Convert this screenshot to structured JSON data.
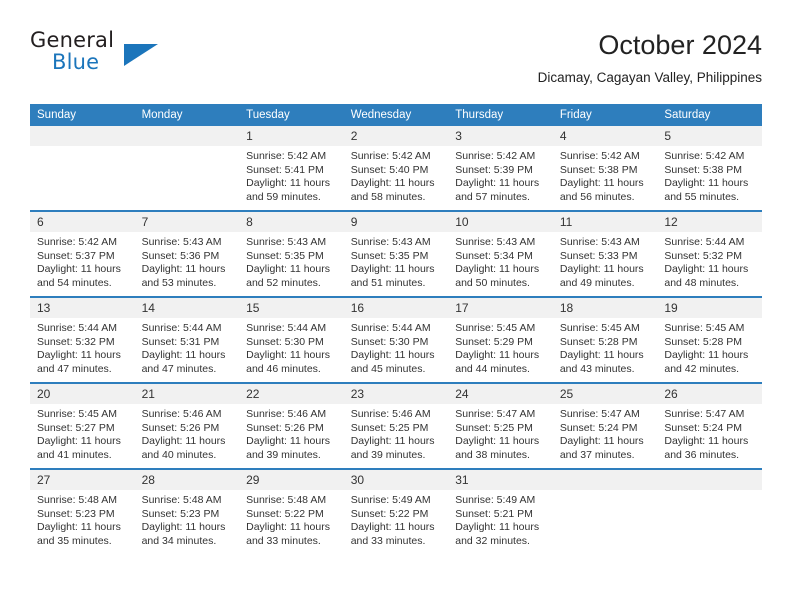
{
  "brand": {
    "name_top": "General",
    "name_bottom": "Blue",
    "triangle_icon": "brand-triangle-icon",
    "accent_color": "#1b75bb"
  },
  "header": {
    "month_title": "October 2024",
    "location": "Dicamay, Cagayan Valley, Philippines"
  },
  "theme": {
    "header_blue": "#2e7ebd",
    "daynum_band": "#f1f1f1",
    "text": "#333333"
  },
  "calendar": {
    "weekday_headers": [
      "Sunday",
      "Monday",
      "Tuesday",
      "Wednesday",
      "Thursday",
      "Friday",
      "Saturday"
    ],
    "labels": {
      "sunrise_prefix": "Sunrise:",
      "sunset_prefix": "Sunset:",
      "daylight_prefix": "Daylight:"
    },
    "weeks": [
      [
        {
          "day": "",
          "sunrise": "",
          "sunset": "",
          "daylight": "",
          "blank": true
        },
        {
          "day": "",
          "sunrise": "",
          "sunset": "",
          "daylight": "",
          "blank": true
        },
        {
          "day": "1",
          "sunrise": "Sunrise: 5:42 AM",
          "sunset": "Sunset: 5:41 PM",
          "daylight": "Daylight: 11 hours and 59 minutes."
        },
        {
          "day": "2",
          "sunrise": "Sunrise: 5:42 AM",
          "sunset": "Sunset: 5:40 PM",
          "daylight": "Daylight: 11 hours and 58 minutes."
        },
        {
          "day": "3",
          "sunrise": "Sunrise: 5:42 AM",
          "sunset": "Sunset: 5:39 PM",
          "daylight": "Daylight: 11 hours and 57 minutes."
        },
        {
          "day": "4",
          "sunrise": "Sunrise: 5:42 AM",
          "sunset": "Sunset: 5:38 PM",
          "daylight": "Daylight: 11 hours and 56 minutes."
        },
        {
          "day": "5",
          "sunrise": "Sunrise: 5:42 AM",
          "sunset": "Sunset: 5:38 PM",
          "daylight": "Daylight: 11 hours and 55 minutes."
        }
      ],
      [
        {
          "day": "6",
          "sunrise": "Sunrise: 5:42 AM",
          "sunset": "Sunset: 5:37 PM",
          "daylight": "Daylight: 11 hours and 54 minutes."
        },
        {
          "day": "7",
          "sunrise": "Sunrise: 5:43 AM",
          "sunset": "Sunset: 5:36 PM",
          "daylight": "Daylight: 11 hours and 53 minutes."
        },
        {
          "day": "8",
          "sunrise": "Sunrise: 5:43 AM",
          "sunset": "Sunset: 5:35 PM",
          "daylight": "Daylight: 11 hours and 52 minutes."
        },
        {
          "day": "9",
          "sunrise": "Sunrise: 5:43 AM",
          "sunset": "Sunset: 5:35 PM",
          "daylight": "Daylight: 11 hours and 51 minutes."
        },
        {
          "day": "10",
          "sunrise": "Sunrise: 5:43 AM",
          "sunset": "Sunset: 5:34 PM",
          "daylight": "Daylight: 11 hours and 50 minutes."
        },
        {
          "day": "11",
          "sunrise": "Sunrise: 5:43 AM",
          "sunset": "Sunset: 5:33 PM",
          "daylight": "Daylight: 11 hours and 49 minutes."
        },
        {
          "day": "12",
          "sunrise": "Sunrise: 5:44 AM",
          "sunset": "Sunset: 5:32 PM",
          "daylight": "Daylight: 11 hours and 48 minutes."
        }
      ],
      [
        {
          "day": "13",
          "sunrise": "Sunrise: 5:44 AM",
          "sunset": "Sunset: 5:32 PM",
          "daylight": "Daylight: 11 hours and 47 minutes."
        },
        {
          "day": "14",
          "sunrise": "Sunrise: 5:44 AM",
          "sunset": "Sunset: 5:31 PM",
          "daylight": "Daylight: 11 hours and 47 minutes."
        },
        {
          "day": "15",
          "sunrise": "Sunrise: 5:44 AM",
          "sunset": "Sunset: 5:30 PM",
          "daylight": "Daylight: 11 hours and 46 minutes."
        },
        {
          "day": "16",
          "sunrise": "Sunrise: 5:44 AM",
          "sunset": "Sunset: 5:30 PM",
          "daylight": "Daylight: 11 hours and 45 minutes."
        },
        {
          "day": "17",
          "sunrise": "Sunrise: 5:45 AM",
          "sunset": "Sunset: 5:29 PM",
          "daylight": "Daylight: 11 hours and 44 minutes."
        },
        {
          "day": "18",
          "sunrise": "Sunrise: 5:45 AM",
          "sunset": "Sunset: 5:28 PM",
          "daylight": "Daylight: 11 hours and 43 minutes."
        },
        {
          "day": "19",
          "sunrise": "Sunrise: 5:45 AM",
          "sunset": "Sunset: 5:28 PM",
          "daylight": "Daylight: 11 hours and 42 minutes."
        }
      ],
      [
        {
          "day": "20",
          "sunrise": "Sunrise: 5:45 AM",
          "sunset": "Sunset: 5:27 PM",
          "daylight": "Daylight: 11 hours and 41 minutes."
        },
        {
          "day": "21",
          "sunrise": "Sunrise: 5:46 AM",
          "sunset": "Sunset: 5:26 PM",
          "daylight": "Daylight: 11 hours and 40 minutes."
        },
        {
          "day": "22",
          "sunrise": "Sunrise: 5:46 AM",
          "sunset": "Sunset: 5:26 PM",
          "daylight": "Daylight: 11 hours and 39 minutes."
        },
        {
          "day": "23",
          "sunrise": "Sunrise: 5:46 AM",
          "sunset": "Sunset: 5:25 PM",
          "daylight": "Daylight: 11 hours and 39 minutes."
        },
        {
          "day": "24",
          "sunrise": "Sunrise: 5:47 AM",
          "sunset": "Sunset: 5:25 PM",
          "daylight": "Daylight: 11 hours and 38 minutes."
        },
        {
          "day": "25",
          "sunrise": "Sunrise: 5:47 AM",
          "sunset": "Sunset: 5:24 PM",
          "daylight": "Daylight: 11 hours and 37 minutes."
        },
        {
          "day": "26",
          "sunrise": "Sunrise: 5:47 AM",
          "sunset": "Sunset: 5:24 PM",
          "daylight": "Daylight: 11 hours and 36 minutes."
        }
      ],
      [
        {
          "day": "27",
          "sunrise": "Sunrise: 5:48 AM",
          "sunset": "Sunset: 5:23 PM",
          "daylight": "Daylight: 11 hours and 35 minutes."
        },
        {
          "day": "28",
          "sunrise": "Sunrise: 5:48 AM",
          "sunset": "Sunset: 5:23 PM",
          "daylight": "Daylight: 11 hours and 34 minutes."
        },
        {
          "day": "29",
          "sunrise": "Sunrise: 5:48 AM",
          "sunset": "Sunset: 5:22 PM",
          "daylight": "Daylight: 11 hours and 33 minutes."
        },
        {
          "day": "30",
          "sunrise": "Sunrise: 5:49 AM",
          "sunset": "Sunset: 5:22 PM",
          "daylight": "Daylight: 11 hours and 33 minutes."
        },
        {
          "day": "31",
          "sunrise": "Sunrise: 5:49 AM",
          "sunset": "Sunset: 5:21 PM",
          "daylight": "Daylight: 11 hours and 32 minutes."
        },
        {
          "day": "",
          "sunrise": "",
          "sunset": "",
          "daylight": "",
          "blank": true
        },
        {
          "day": "",
          "sunrise": "",
          "sunset": "",
          "daylight": "",
          "blank": true
        }
      ]
    ]
  }
}
